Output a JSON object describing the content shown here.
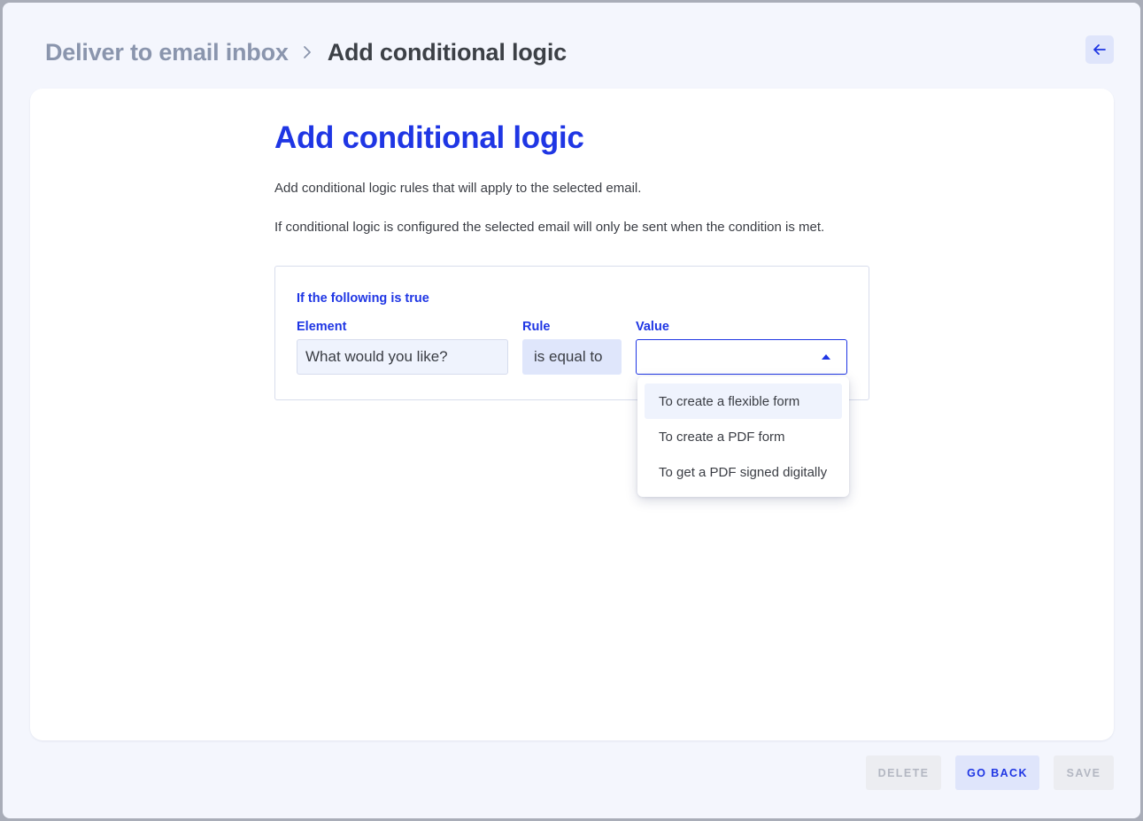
{
  "breadcrumb": {
    "parent": "Deliver to email inbox",
    "current": "Add conditional logic"
  },
  "header": {
    "back_icon": "arrow-left-icon"
  },
  "main": {
    "heading": "Add conditional logic",
    "description_1": "Add conditional logic rules that will apply to the selected email.",
    "description_2": "If conditional logic is configured the selected email will only be sent when the condition is met."
  },
  "rule": {
    "title": "If the following is true",
    "element_label": "Element",
    "element_value": "What would you like?",
    "rule_label": "Rule",
    "rule_value": "is equal to",
    "value_label": "Value",
    "value_selected": "",
    "value_options": [
      "To create a flexible form",
      "To create a PDF form",
      "To get a PDF signed digitally"
    ]
  },
  "footer": {
    "delete_label": "DELETE",
    "goback_label": "GO BACK",
    "save_label": "SAVE"
  },
  "colors": {
    "accent": "#1f36e4",
    "background": "#f4f6fd",
    "card": "#ffffff",
    "muted": "#8a95ad"
  }
}
